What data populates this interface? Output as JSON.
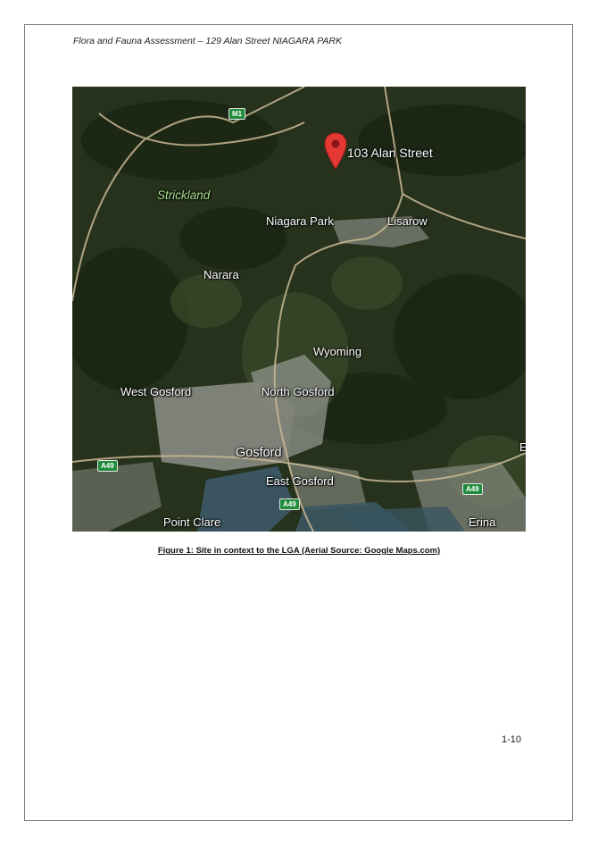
{
  "header": {
    "title": "Flora and Fauna Assessment – 129 Alan Street NIAGARA PARK"
  },
  "map": {
    "site_label": "103 Alan Street",
    "places": {
      "strickland": "Strickland",
      "niagara_park": "Niagara Park",
      "lisarow": "Lisarow",
      "narara": "Narara",
      "wyoming": "Wyoming",
      "west_gosford": "West Gosford",
      "north_gosford": "North Gosford",
      "gosford": "Gosford",
      "east_gosford": "East Gosford",
      "point_clare": "Point Clare",
      "erina": "Erina",
      "edge_e": "E"
    },
    "roads": {
      "m1": "M1",
      "a49_west": "A49",
      "a49_center": "A49",
      "a49_east": "A49"
    },
    "colors": {
      "forest": "#25301c",
      "urban": "#8f9189",
      "water": "#3a5560",
      "pin": "#e53935",
      "shield": "#1f8b3b"
    }
  },
  "caption": "Figure 1: Site in context to the LGA (Aerial Source: Google Maps.com)",
  "page_number": "1-10"
}
